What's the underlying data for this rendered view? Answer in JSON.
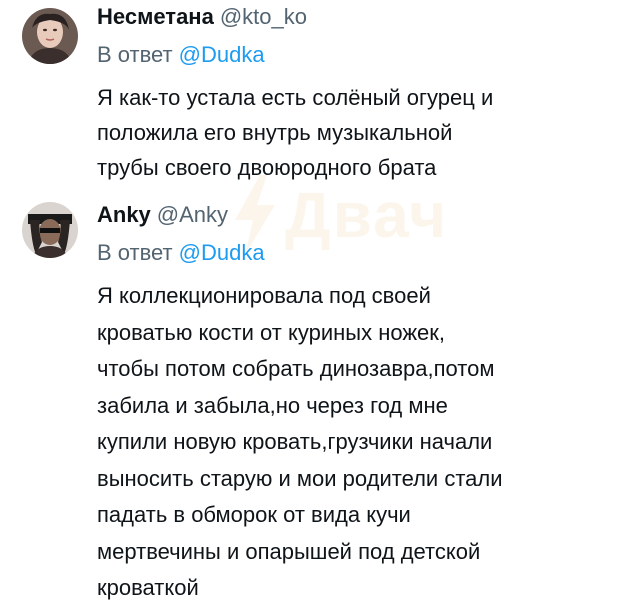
{
  "tweets": [
    {
      "name": "Несметана",
      "handle": "@kto_ko",
      "reply_prefix": "В ответ",
      "reply_to": "@Dudka",
      "text": "Я как-то устала есть солёный огурец и\nположила его внутрь музыкальной\nтрубы своего двоюродного брата"
    },
    {
      "name": "Anky",
      "handle": "@Anky",
      "reply_prefix": "В ответ",
      "reply_to": "@Dudka",
      "text": "Я коллекционировала под своей\nкроватью кости от куриных ножек,\nчтобы потом собрать динозавра,потом\nзабила и забыла,но через год мне\nкупили новую кровать,грузчики начали\nвыносить старую и мои родители стали\nпадать в обморок от вида кучи\nмертвечины и опарышей под детской\nкроваткой"
    }
  ],
  "watermark": {
    "text": "Двач",
    "color": "#e48a1a"
  }
}
